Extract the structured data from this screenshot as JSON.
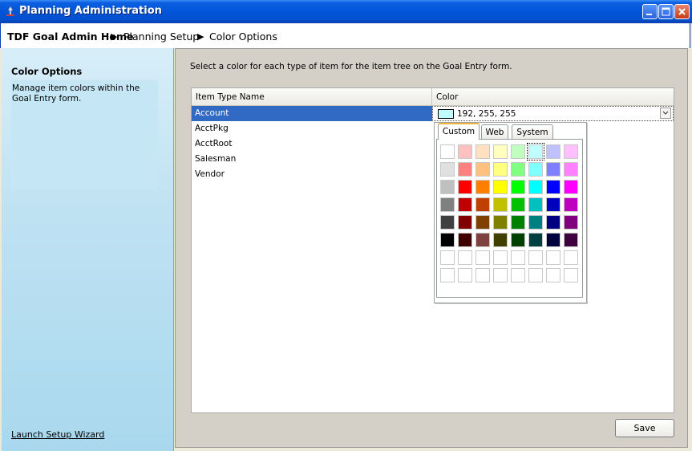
{
  "window": {
    "title": "Planning Administration",
    "icons": {
      "app": "app-icon",
      "minimize": "minimize-icon",
      "maximize": "maximize-icon",
      "close": "close-icon"
    }
  },
  "breadcrumb": {
    "home": "TDF Goal Admin Home",
    "setup": "Planning Setup",
    "options": "Color Options",
    "separator_icon": "arrow-right-icon"
  },
  "sidebar": {
    "title": "Color Options",
    "description": "Manage item colors within the Goal Entry form.",
    "launch_link": "Launch Setup Wizard"
  },
  "main": {
    "instructions": "Select a color for each type of item for the item tree on the Goal Entry form.",
    "grid": {
      "columns": [
        "Item Type Name",
        "Color"
      ],
      "rows": [
        {
          "name": "Account",
          "selected": true
        },
        {
          "name": "AcctPkg"
        },
        {
          "name": "AcctRoot"
        },
        {
          "name": "Salesman"
        },
        {
          "name": "Vendor"
        }
      ],
      "selected_color": {
        "swatch": "#c0ffff",
        "value": "192, 255, 255"
      }
    },
    "save_label": "Save"
  },
  "color_picker": {
    "tabs": [
      "Custom",
      "Web",
      "System"
    ],
    "active_tab": "Custom",
    "palette": [
      [
        "#ffffff",
        "#ffc0c0",
        "#ffe0c0",
        "#ffffc0",
        "#c0ffc0",
        "#c0ffff",
        "#c0c0ff",
        "#ffc0ff"
      ],
      [
        "#e0e0e0",
        "#ff8080",
        "#ffc080",
        "#ffff80",
        "#80ff80",
        "#80ffff",
        "#8080ff",
        "#ff80ff"
      ],
      [
        "#c0c0c0",
        "#ff0000",
        "#ff8000",
        "#ffff00",
        "#00ff00",
        "#00ffff",
        "#0000ff",
        "#ff00ff"
      ],
      [
        "#808080",
        "#c00000",
        "#c04000",
        "#c0c000",
        "#00c000",
        "#00c0c0",
        "#0000c0",
        "#c000c0"
      ],
      [
        "#404040",
        "#800000",
        "#804000",
        "#808000",
        "#008000",
        "#008080",
        "#000080",
        "#800080"
      ],
      [
        "#000000",
        "#400000",
        "#804040",
        "#404000",
        "#004000",
        "#004040",
        "#000040",
        "#400040"
      ],
      [
        "#ffffff",
        "#ffffff",
        "#ffffff",
        "#ffffff",
        "#ffffff",
        "#ffffff",
        "#ffffff",
        "#ffffff"
      ],
      [
        "#ffffff",
        "#ffffff",
        "#ffffff",
        "#ffffff",
        "#ffffff",
        "#ffffff",
        "#ffffff",
        "#ffffff"
      ]
    ],
    "selected_index": [
      0,
      5
    ]
  },
  "colors": {
    "title_bar": "#0454d8",
    "selection": "#316ac5",
    "sidebar": "#bfe2f2",
    "panel": "#d4d0c8",
    "tab_highlight": "#f0b33c"
  }
}
